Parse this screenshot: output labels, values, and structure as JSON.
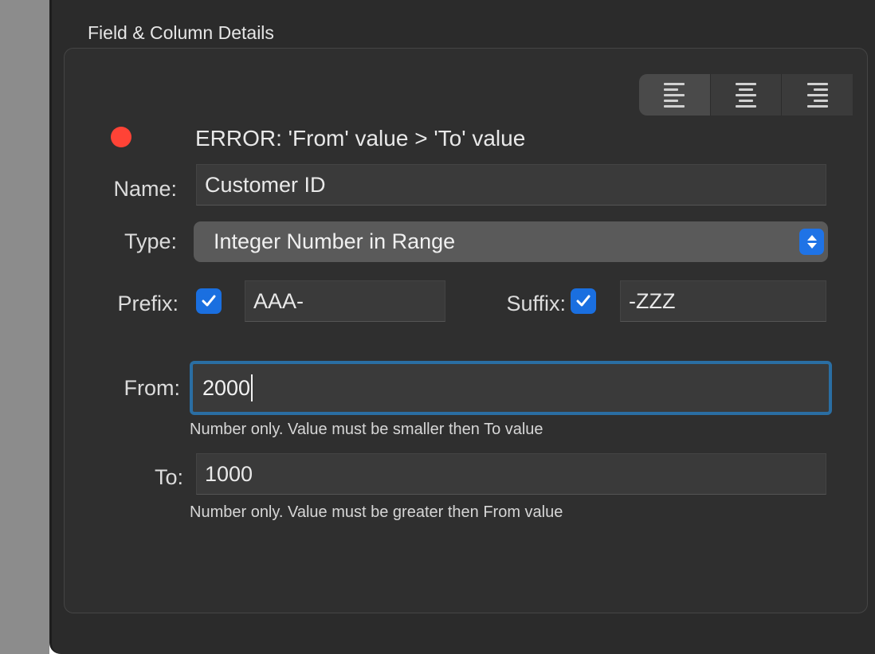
{
  "panel": {
    "title": "Field & Column Details"
  },
  "alignment": {
    "options": [
      "align-left",
      "align-center",
      "align-right"
    ],
    "selected": "align-left"
  },
  "error": {
    "message": "ERROR: 'From' value > 'To' value",
    "color": "#ff4336"
  },
  "name": {
    "label": "Name:",
    "value": "Customer ID"
  },
  "type": {
    "label": "Type:",
    "value": "Integer Number in Range"
  },
  "prefix": {
    "label": "Prefix:",
    "checked": true,
    "value": "AAA-"
  },
  "suffix": {
    "label": "Suffix:",
    "checked": true,
    "value": "-ZZZ"
  },
  "from": {
    "label": "From:",
    "value": "2000",
    "help": "Number only. Value must be smaller then To value"
  },
  "to": {
    "label": "To:",
    "value": "1000",
    "help": "Number only. Value must be greater then From value"
  },
  "colors": {
    "accent": "#1a6fe0",
    "focus_ring": "#2a6ea3",
    "background": "#2b2b2b"
  }
}
